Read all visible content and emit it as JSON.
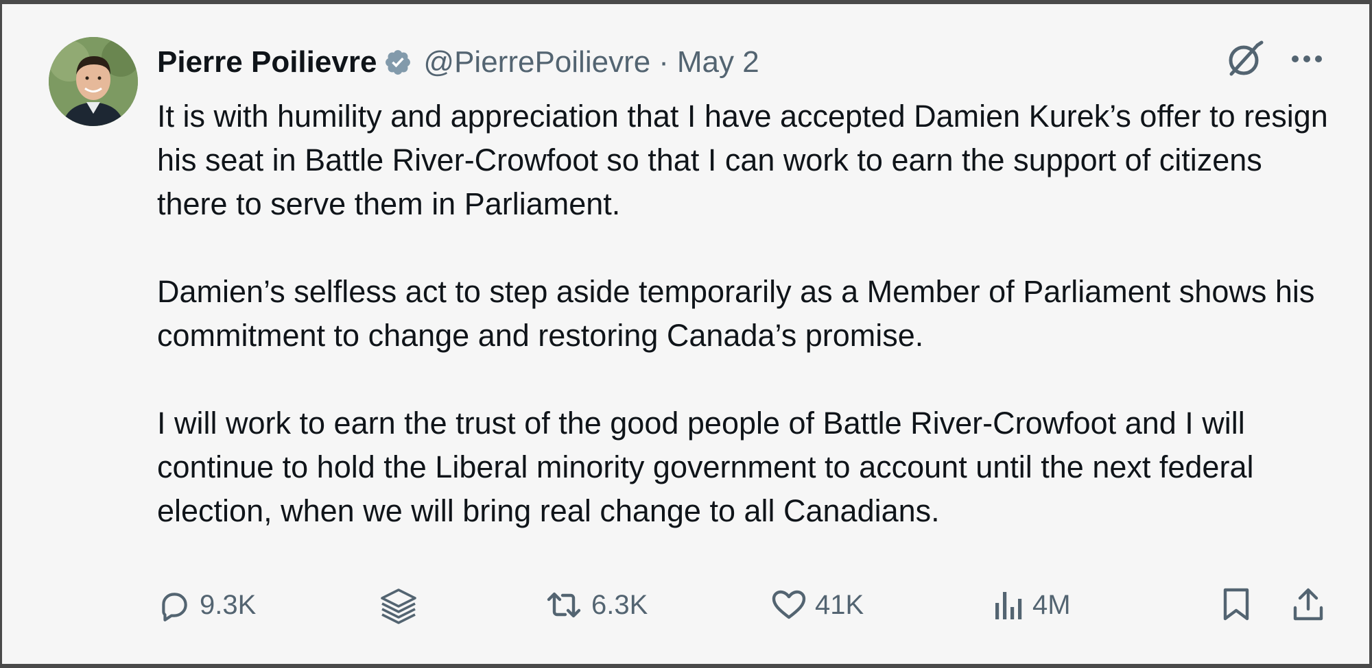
{
  "tweet": {
    "author_name": "Pierre Poilievre",
    "handle": "@PierrePoilievre",
    "separator": "·",
    "date": "May 2",
    "paragraphs": [
      "It is with humility and appreciation that I have accepted Damien Kurek’s offer to resign his seat in Battle River-Crowfoot so that I can work to earn the support of citizens there to serve them in Parliament.",
      "Damien’s selfless act to step aside temporarily as a Member of Parliament shows his commitment to change and restoring Canada’s promise.",
      "I will work to earn the trust of the good people of Battle River-Crowfoot and I will continue to hold the Liberal minority government to account until the next federal election, when we will bring real change to all Canadians."
    ]
  },
  "actions": {
    "replies": "9.3K",
    "reposts": "6.3K",
    "likes": "41K",
    "views": "4M"
  },
  "icons": {
    "verified": "verified-badge-icon",
    "grok": "grok-icon",
    "more": "more-icon",
    "reply": "reply-icon",
    "layers": "layers-icon",
    "repost": "repost-icon",
    "like": "heart-icon",
    "views": "views-icon",
    "bookmark": "bookmark-icon",
    "share": "share-icon"
  },
  "colors": {
    "text_primary": "#0f1419",
    "text_secondary": "#536471",
    "card_background": "#f6f6f6",
    "verified_badge": "#829aab"
  }
}
